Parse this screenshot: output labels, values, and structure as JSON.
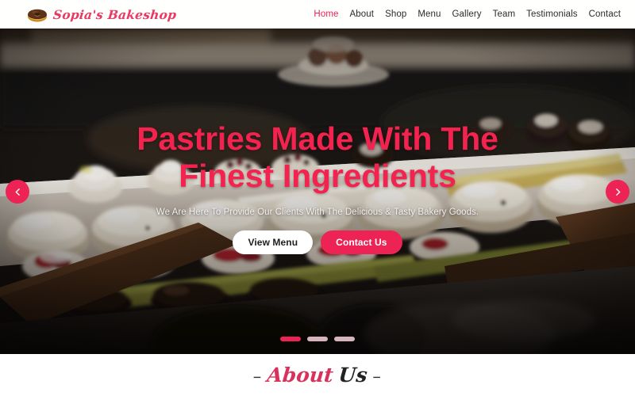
{
  "header": {
    "brand": {
      "name": "Sopia's Bakeshop",
      "logo_icon": "donut-icon"
    },
    "nav": [
      {
        "label": "Home",
        "active": true
      },
      {
        "label": "About",
        "active": false
      },
      {
        "label": "Shop",
        "active": false
      },
      {
        "label": "Menu",
        "active": false
      },
      {
        "label": "Gallery",
        "active": false
      },
      {
        "label": "Team",
        "active": false
      },
      {
        "label": "Testimonials",
        "active": false
      },
      {
        "label": "Contact",
        "active": false
      }
    ]
  },
  "hero": {
    "title": "Pastries Made With The Finest Ingredients",
    "subtitle": "We Are Here To Provide Our Clients With The Delicious & Tasty Bakery Goods.",
    "buttons": {
      "primary": "View Menu",
      "secondary": "Contact Us"
    },
    "carousel": {
      "prev_icon": "chevron-left-icon",
      "next_icon": "chevron-right-icon",
      "slide_count": 3,
      "active_slide": 1
    },
    "background_description": "bakery display case filled with assorted pastries and donuts"
  },
  "about": {
    "dash_left": "–",
    "word_accent": "About",
    "word_dark": "Us",
    "dash_right": "–"
  },
  "colors": {
    "accent": "#ec2354",
    "accent_title": "#f3224f",
    "brand_text": "#e83a62",
    "about_accent": "#d8315b",
    "nav_text": "#2b2b2b",
    "dot_inactive": "#d6b4bc"
  }
}
